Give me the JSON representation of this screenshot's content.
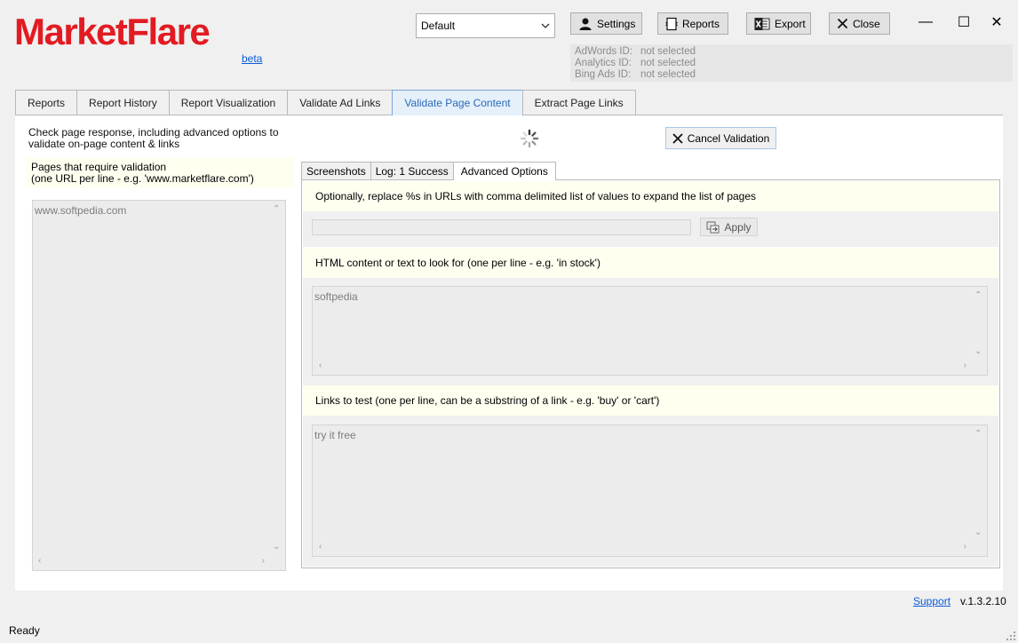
{
  "app": {
    "logo": "MarketFlare",
    "beta_link": "beta"
  },
  "window_controls": {
    "minimize": "—",
    "maximize": "☐",
    "close": "✕"
  },
  "profile_select": {
    "value": "Default"
  },
  "toolbar": {
    "settings_label": "Settings",
    "reports_label": "Reports",
    "export_label": "Export",
    "close_label": "Close"
  },
  "ids": [
    {
      "key": "AdWords ID:",
      "value": "not selected"
    },
    {
      "key": "Analytics ID:",
      "value": "not selected"
    },
    {
      "key": "Bing Ads ID:",
      "value": "not selected"
    }
  ],
  "main_tabs": [
    {
      "label": "Reports"
    },
    {
      "label": "Report History"
    },
    {
      "label": "Report Visualization"
    },
    {
      "label": "Validate Ad Links"
    },
    {
      "label": "Validate Page Content",
      "active": true
    },
    {
      "label": "Extract Page Links"
    }
  ],
  "left_panel": {
    "description": "Check page response, including advanced options to validate on-page content & links",
    "pages_label_line1": "Pages that require validation",
    "pages_label_line2": "(one URL per line - e.g. 'www.marketflare.com')",
    "urls_value": "www.softpedia.com"
  },
  "cancel_button_label": "Cancel Validation",
  "inner_tabs": [
    {
      "label": "Screenshots"
    },
    {
      "label": "Log: 1 Success"
    },
    {
      "label": "Advanced Options",
      "active": true
    }
  ],
  "advanced": {
    "replace_label": "Optionally, replace %s in URLs with comma delimited list of values to expand the list of pages",
    "replace_value": "",
    "apply_label": "Apply",
    "content_label": "HTML content or text to look for (one per line - e.g. 'in stock')",
    "content_value": "softpedia",
    "links_label": "Links to test (one per line, can be a substring of a link - e.g. 'buy' or 'cart')",
    "links_value": "try it free"
  },
  "footer": {
    "support_link": "Support",
    "version": "v.1.3.2.10",
    "status": "Ready"
  },
  "colors": {
    "brand_red": "#e21b22",
    "link_blue": "#0b5ad9",
    "active_tab_text": "#2a6ab9",
    "label_band": "#fffff0"
  }
}
